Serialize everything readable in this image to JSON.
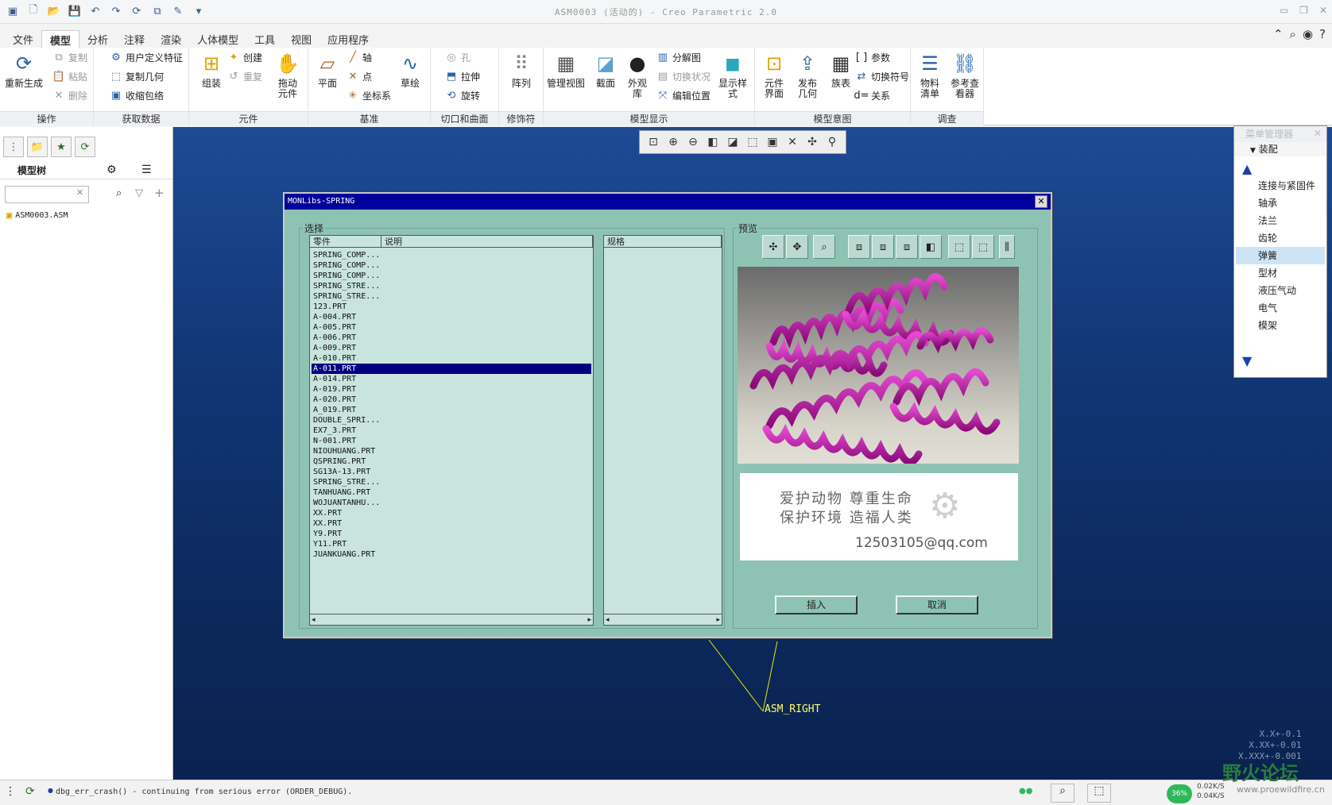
{
  "window": {
    "title": "ASM0003 (活动的) - Creo Parametric 2.0"
  },
  "menu_tabs": [
    "文件",
    "模型",
    "分析",
    "注释",
    "渲染",
    "人体模型",
    "工具",
    "视图",
    "应用程序"
  ],
  "ribbon": {
    "groups": [
      "操作",
      "获取数据",
      "元件",
      "基准",
      "切口和曲面",
      "修饰符",
      "模型显示",
      "模型意图",
      "调查"
    ],
    "buttons": {
      "regenerate": "重新生成",
      "copy": "复制",
      "paste": "粘贴",
      "delete": "删除",
      "udf": "用户定义特征",
      "copy_geom": "复制几何",
      "shrinkwrap": "收缩包络",
      "assemble": "组装",
      "create": "创建",
      "repeat": "重复",
      "drag": "拖动",
      "drag2": "元件",
      "plane": "平面",
      "axis": "轴",
      "point": "点",
      "csys": "坐标系",
      "sketch": "草绘",
      "hole": "孔",
      "extrude": "拉伸",
      "revolve": "旋转",
      "pattern": "阵列",
      "manage_view": "管理视图",
      "section": "截面",
      "appearance": "外观",
      "appearance2": "库",
      "explode": "分解图",
      "toggle_status": "切换状况",
      "edit_pos": "编辑位置",
      "display_style": "显示样",
      "display_style2": "式",
      "comp_if": "元件",
      "comp_if2": "界面",
      "publish": "发布",
      "publish2": "几何",
      "family": "族表",
      "params": "参数",
      "switch_sym": "切换符号",
      "relations": "关系",
      "bom": "物料",
      "bom2": "清单",
      "ref_viewer": "参考查",
      "ref_viewer2": "看器"
    }
  },
  "left_panel": {
    "header": "模型树",
    "tree_root": "ASM0003.ASM"
  },
  "right_panel": {
    "title": "菜单管理器",
    "subtitle": "装配",
    "items": [
      "连接与紧固件",
      "轴承",
      "法兰",
      "齿轮",
      "弹簧",
      "型材",
      "液压气动",
      "电气",
      "模架"
    ],
    "selected_index": 4
  },
  "dialog": {
    "title": "MONLibs-SPRING",
    "select_label": "选择",
    "col_part": "零件",
    "col_desc": "说明",
    "col_spec": "规格",
    "preview_label": "预览",
    "parts": [
      "SPRING_COMP...",
      "SPRING_COMP...",
      "SPRING_COMP...",
      "SPRING_STRE...",
      "SPRING_STRE...",
      "123.PRT",
      "A-004.PRT",
      "A-005.PRT",
      "A-006.PRT",
      "A-009.PRT",
      "A-010.PRT",
      "A-011.PRT",
      "A-014.PRT",
      "A-019.PRT",
      "A-020.PRT",
      "A_019.PRT",
      "DOUBLE_SPRI...",
      "EX7_3.PRT",
      "N-001.PRT",
      "NIOUHUANG.PRT",
      "QSPRING.PRT",
      "SG13A-13.PRT",
      "SPRING_STRE...",
      "TANHUANG.PRT",
      "WOJUANTANHU...",
      "XX.PRT",
      "XX.PRT",
      "Y9.PRT",
      "Y11.PRT",
      "JUANKUANG.PRT"
    ],
    "selected_part_index": 11,
    "banner_line1": "爱护动物  尊重生命",
    "banner_line2": "保护环境  造福人类",
    "banner_email": "12503105@qq.com",
    "insert": "插入",
    "cancel": "取消"
  },
  "viewport": {
    "datum_label": "ASM_RIGHT",
    "accuracy": [
      "X.X+-0.1",
      "X.XX+-0.01",
      "X.XXX+-0.001"
    ]
  },
  "status": {
    "message": "dbg_err_crash() - continuing from serious error (ORDER_DEBUG).",
    "net_percent": "36%",
    "net_up": "0.02K/S",
    "net_down": "0.04K/S",
    "watermark": "野火论坛",
    "watermark_url": "www.proewildfire.cn"
  },
  "colors": {
    "dialog_bg": "#8ec3b4",
    "selection": "#000080",
    "spring": "#c21fa6",
    "viewport_top": "#1e4a95"
  }
}
